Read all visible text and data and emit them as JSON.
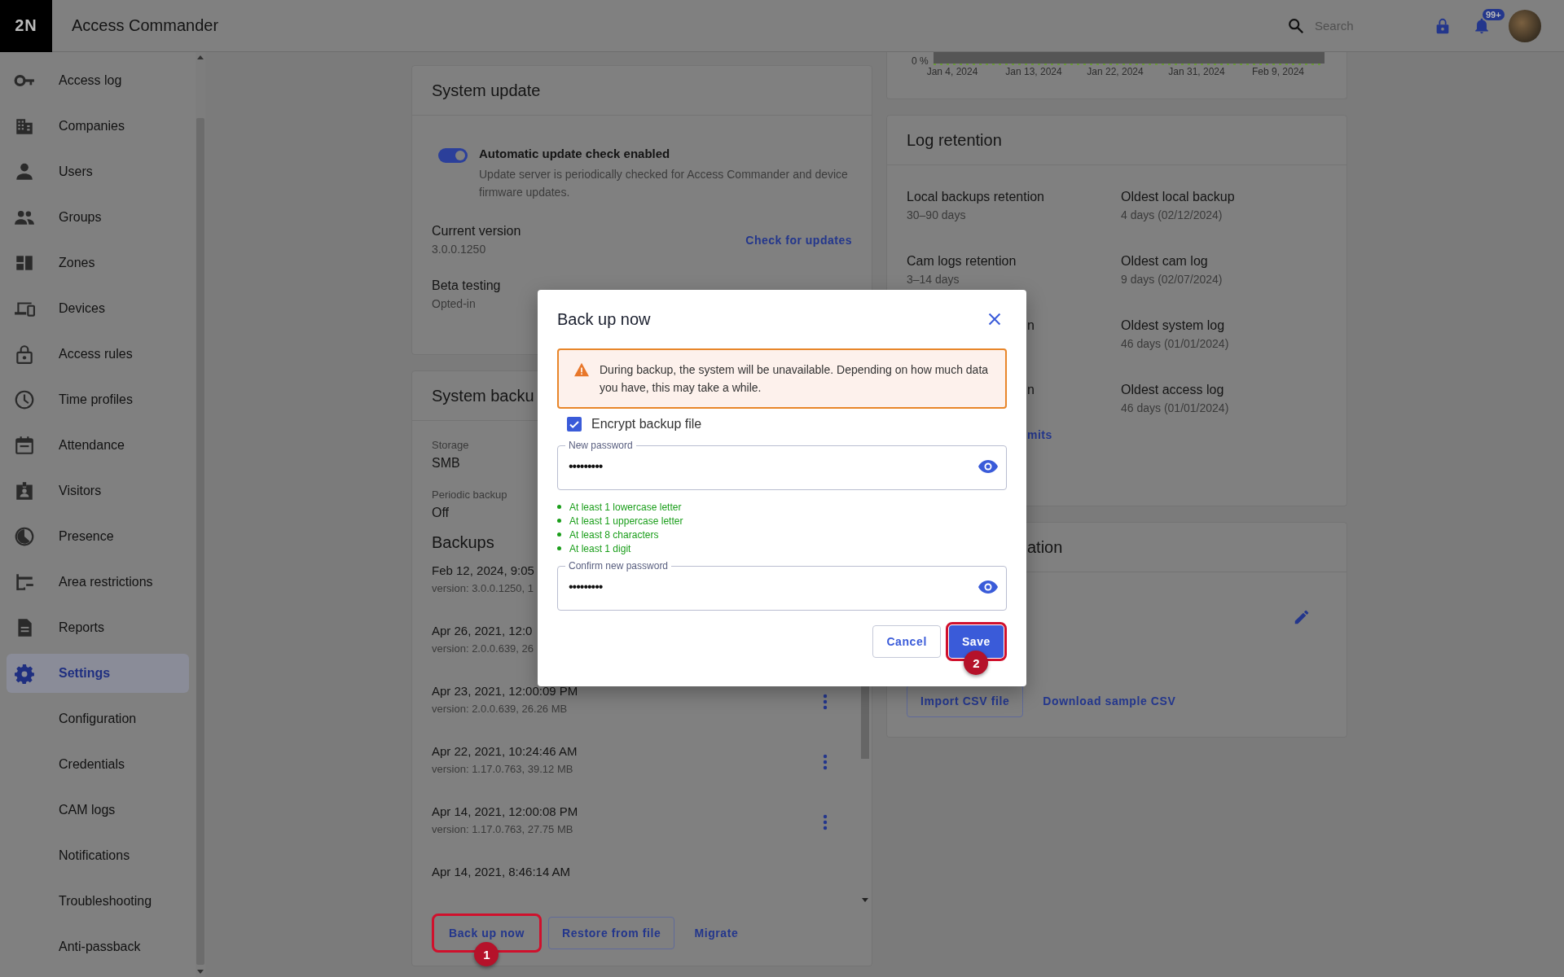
{
  "app": {
    "logo": "2N",
    "title": "Access Commander"
  },
  "search": {
    "placeholder": "Search"
  },
  "notifications": {
    "badge": "99+"
  },
  "sidebar": {
    "items": [
      {
        "label": "Access log",
        "selected": false
      },
      {
        "label": "Companies",
        "selected": false
      },
      {
        "label": "Users",
        "selected": false
      },
      {
        "label": "Groups",
        "selected": false
      },
      {
        "label": "Zones",
        "selected": false
      },
      {
        "label": "Devices",
        "selected": false
      },
      {
        "label": "Access rules",
        "selected": false
      },
      {
        "label": "Time profiles",
        "selected": false
      },
      {
        "label": "Attendance",
        "selected": false
      },
      {
        "label": "Visitors",
        "selected": false
      },
      {
        "label": "Presence",
        "selected": false
      },
      {
        "label": "Area restrictions",
        "selected": false
      },
      {
        "label": "Reports",
        "selected": false
      },
      {
        "label": "Settings",
        "selected": true,
        "children": [
          {
            "label": "Configuration",
            "selected": false
          },
          {
            "label": "Credentials",
            "selected": false
          },
          {
            "label": "CAM logs",
            "selected": false
          },
          {
            "label": "Notifications",
            "selected": false
          },
          {
            "label": "Troubleshooting",
            "selected": false
          },
          {
            "label": "Anti-passback",
            "selected": false
          }
        ]
      }
    ]
  },
  "system_update": {
    "title": "System update",
    "toggle": {
      "label": "Automatic update check enabled",
      "description": "Update server is periodically checked for Access Commander and device firmware updates.",
      "on": true
    },
    "current_version": {
      "label": "Current version",
      "value": "3.0.0.1250"
    },
    "check_link": "Check for updates",
    "beta": {
      "label": "Beta testing",
      "value": "Opted-in"
    }
  },
  "system_backup": {
    "title": "System backu",
    "fields": [
      {
        "label": "Storage",
        "value": "SMB"
      },
      {
        "label": "Periodic backup",
        "value": "Off"
      }
    ],
    "backups_title": "Backups",
    "backups": [
      {
        "date": "Feb 12, 2024, 9:05",
        "info": "version: 3.0.0.1250, 1",
        "menu": false
      },
      {
        "date": "Apr 26, 2021, 12:0",
        "info": "version: 2.0.0.639, 26",
        "menu": false
      },
      {
        "date": "Apr 23, 2021, 12:00:09 PM",
        "info": "version: 2.0.0.639, 26.26 MB",
        "menu": true
      },
      {
        "date": "Apr 22, 2021, 10:24:46 AM",
        "info": "version: 1.17.0.763, 39.12 MB",
        "menu": true
      },
      {
        "date": "Apr 14, 2021, 12:00:08 PM",
        "info": "version: 1.17.0.763, 27.75 MB",
        "menu": true
      },
      {
        "date": "Apr 14, 2021, 8:46:14 AM",
        "menu": false
      }
    ],
    "actions": [
      {
        "label": "Back up now",
        "kind": "outlined",
        "step": "1"
      },
      {
        "label": "Restore from file",
        "kind": "outlined"
      },
      {
        "label": "Migrate",
        "kind": "text"
      }
    ]
  },
  "usage_chart": {
    "y_tick": "0 %",
    "x_ticks": [
      "Jan 4, 2024",
      "Jan 13, 2024",
      "Jan 22, 2024",
      "Jan 31, 2024",
      "Feb 9, 2024"
    ]
  },
  "log_retention": {
    "title": "Log retention",
    "items": [
      {
        "label": "Local backups retention",
        "value": "30–90 days"
      },
      {
        "label": "Oldest local backup",
        "value": "4 days (02/12/2024)"
      },
      {
        "label": "Cam logs retention",
        "value": "3–14 days"
      },
      {
        "label": "Oldest cam log",
        "value": "9 days (02/07/2024)"
      },
      {
        "label": "n"
      },
      {
        "label": "Oldest system log",
        "value": "46 days (01/01/2024)"
      },
      {
        "label": "n"
      },
      {
        "label": "Oldest access log",
        "value": "46 days (01/01/2024)"
      }
    ],
    "link": "mits"
  },
  "import_card": {
    "title": "ation",
    "buttons": [
      {
        "label": "Import CSV file",
        "kind": "outlined"
      },
      {
        "label": "Download sample CSV",
        "kind": "text"
      }
    ]
  },
  "dialog": {
    "title": "Back up now",
    "warning": "During backup, the system will be unavailable. Depending on how much data you have, this may take a while.",
    "encrypt": {
      "label": "Encrypt backup file",
      "checked": true
    },
    "fields": [
      {
        "label": "New password",
        "value": "•••••••••"
      },
      {
        "label": "Confirm new password",
        "value": "•••••••••"
      }
    ],
    "rules": [
      {
        "text": "At least 1 lowercase letter",
        "met": true
      },
      {
        "text": "At least 1 uppercase letter",
        "met": true
      },
      {
        "text": "At least 8 characters",
        "met": true
      },
      {
        "text": "At least 1 digit",
        "met": true
      }
    ],
    "buttons": [
      {
        "label": "Cancel",
        "kind": "outlined"
      },
      {
        "label": "Save",
        "kind": "primary",
        "step": "2"
      }
    ]
  }
}
